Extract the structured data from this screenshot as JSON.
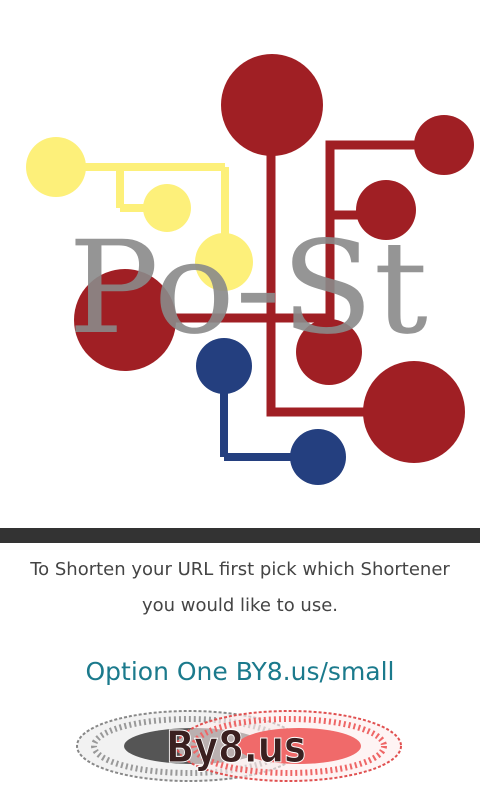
{
  "logo": {
    "text": "Po-St",
    "colors": {
      "red": "#a01f24",
      "yellow": "#fdf07a",
      "blue": "#243f7f",
      "gray": "#8a8a8a"
    }
  },
  "intro_text": "To Shorten your URL first pick which Shortener you would like to use.",
  "option_one": {
    "label": "Option One BY8.us/small",
    "color": "#1b7a8c"
  },
  "by8_logo": {
    "text": "By8.us"
  }
}
